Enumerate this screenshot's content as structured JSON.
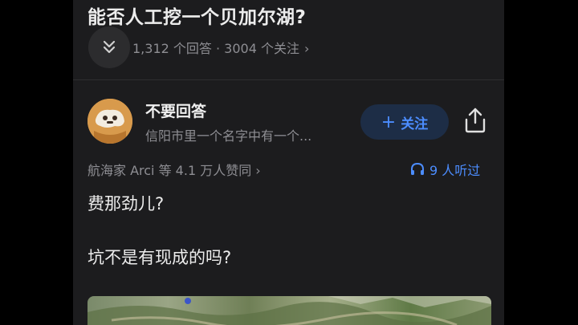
{
  "question": {
    "title": "能否人工挖一个贝加尔湖?",
    "meta": "1,312 个回答 · 3004 个关注",
    "meta_chevron": "›"
  },
  "author": {
    "name": "不要回答",
    "bio": "信阳市里一个名字中有一个...",
    "follow_label": "关注",
    "follow_plus": "+"
  },
  "stats": {
    "upvote_text": "航海家 Arci 等 4.1 万人赞同 ›",
    "listen_text": "9 人听过"
  },
  "answer": {
    "paragraphs": [
      "费那劲儿?",
      "坑不是有现成的吗?"
    ]
  },
  "colors": {
    "accent": "#4c8dff",
    "background": "#1c1c1e",
    "muted": "#8e8e93"
  },
  "icons": {
    "collapse": "double-chevron-down-icon",
    "share": "share-icon",
    "headphones": "headphones-icon"
  }
}
